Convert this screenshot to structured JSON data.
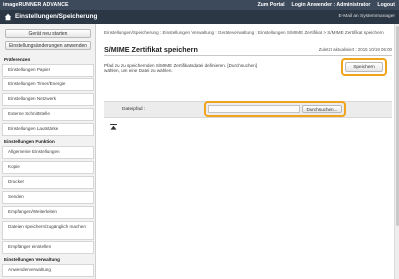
{
  "topbar": {
    "brand": "imageRUNNER ADVANCE",
    "links": [
      "Zum Portal",
      "Login Anwender : Administrator",
      "Logout"
    ]
  },
  "titlebar": {
    "title": "Einstellungen/Speicherung",
    "mail_link": "E-Mail an Systemmanager"
  },
  "sidebar": {
    "restart_button": "Gerät neu starten",
    "apply_button": "Einstellungsänderungen anwenden",
    "section1": "Präferenzen",
    "items1": [
      "Einstellungen Papier",
      "Einstellungen Timer/Energie",
      "Einstellungen Netzwerk",
      "Externe Schnittstelle",
      "Einstellungen Lautstärke"
    ],
    "section2": "Einstellungen Funktion",
    "items2": [
      "Allgemeine Einstellungen",
      "Kopie",
      "Drucker",
      "Senden",
      "Empfangen/Weiterleiten",
      "Dateien speichern/zugänglich machen",
      "Empfänger einstellen"
    ],
    "section3": "Einstellungen Verwaltung",
    "items3": [
      "Anwenderverwaltung"
    ]
  },
  "main": {
    "breadcrumb": "Einstellungen/Speicherung : Einstellungen Verwaltung : Geräteverwaltung : Einstellungen S/MIME Zertifikat > S/MIME Zertifikat speichern",
    "title": "S/MIME Zertifikat speichern",
    "last_updated": "Zuletzt aktualisiert : 2015 10/19 06:00",
    "instruction": "Pfad zu zu speichernden S/MIME Zertifikatsdatei definieren. [Durchsuchen] wählen, um eine Datei zu wählen.",
    "save_button": "Speichern",
    "file_path_label": "Dateipfad :",
    "file_path_value": "",
    "browse_button": "Durchsuchen..."
  },
  "colors": {
    "header_dark": "#2c3746",
    "highlight": "#f0a41e"
  }
}
